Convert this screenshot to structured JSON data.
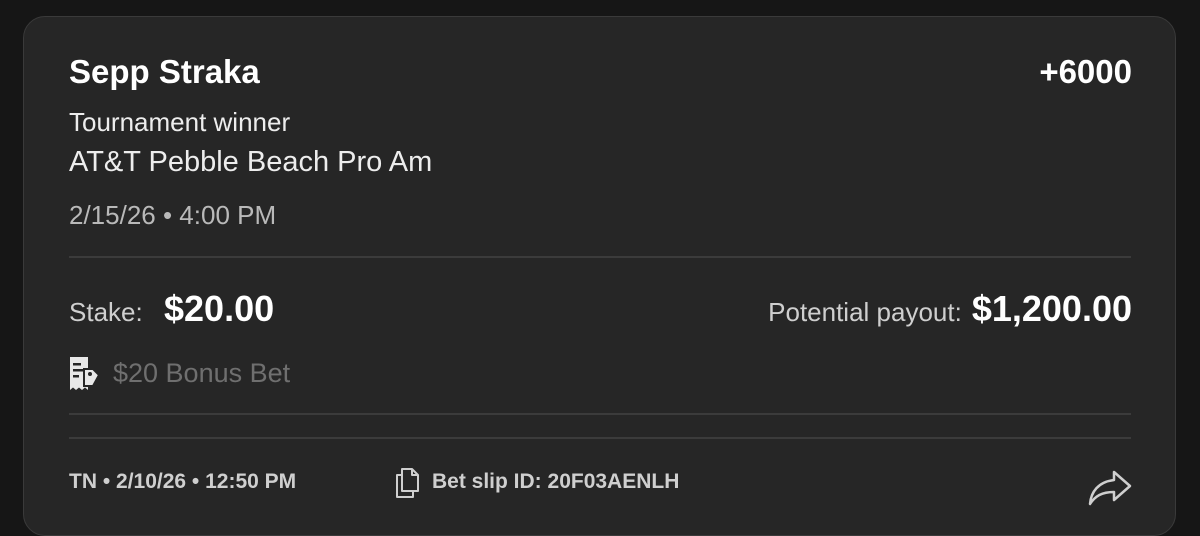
{
  "bet": {
    "selection": "Sepp Straka",
    "odds": "+6000",
    "market": "Tournament winner",
    "event": "AT&T Pebble Beach Pro Am",
    "event_datetime": "2/15/26 • 4:00 PM"
  },
  "wager": {
    "stake_label": "Stake:",
    "stake_value": "$20.00",
    "payout_label": "Potential payout:",
    "payout_value": "$1,200.00",
    "bonus_text": "$20 Bonus Bet"
  },
  "footer": {
    "meta": "TN • 2/10/26 • 12:50 PM",
    "slip_id": "Bet slip ID: 20F03AENLH"
  },
  "icons": {
    "bonus": "bonus-bet-ticket-icon",
    "copy": "document-copy-icon",
    "share": "share-arrow-icon"
  },
  "colors": {
    "background": "#161616",
    "card": "#262626",
    "primary_text": "#ffffff",
    "muted_text": "#6f6f6f"
  }
}
